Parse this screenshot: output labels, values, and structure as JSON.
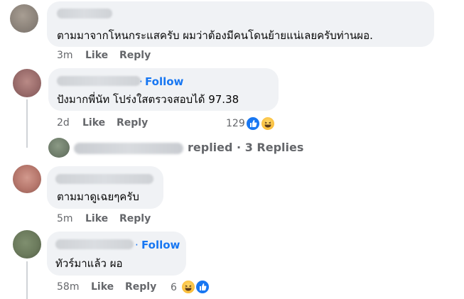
{
  "comments": [
    {
      "text": "ตามมาจากโหนกระแสครับ ผมว่าต้องมีคนโดนย้ายแน่เลยครับท่านผอ.",
      "time": "3m",
      "like_label": "Like",
      "reply_label": "Reply"
    },
    {
      "follow_label": "Follow",
      "follow_dot": "·",
      "text": "ปังมากพี่นัท โปร่งใสตรวจสอบได้ 97.38",
      "time": "2d",
      "like_label": "Like",
      "reply_label": "Reply",
      "reaction_count": "129",
      "reactions": [
        "like-icon",
        "haha-icon"
      ]
    },
    {
      "text": "ตามมาดูเฉยๆครับ",
      "time": "5m",
      "like_label": "Like",
      "reply_label": "Reply"
    },
    {
      "follow_label": "Follow",
      "follow_dot": "·",
      "text": "ทัวร์มาแล้ว ผอ",
      "time": "58m",
      "like_label": "Like",
      "reply_label": "Reply",
      "reaction_count": "6",
      "reactions": [
        "haha-icon",
        "like-icon"
      ]
    }
  ],
  "replies_summary": {
    "text": "replied · 3 Replies"
  },
  "colors": {
    "bubble": "#f0f2f5",
    "meta": "#65676b",
    "follow": "#1877f2",
    "text": "#050505"
  }
}
